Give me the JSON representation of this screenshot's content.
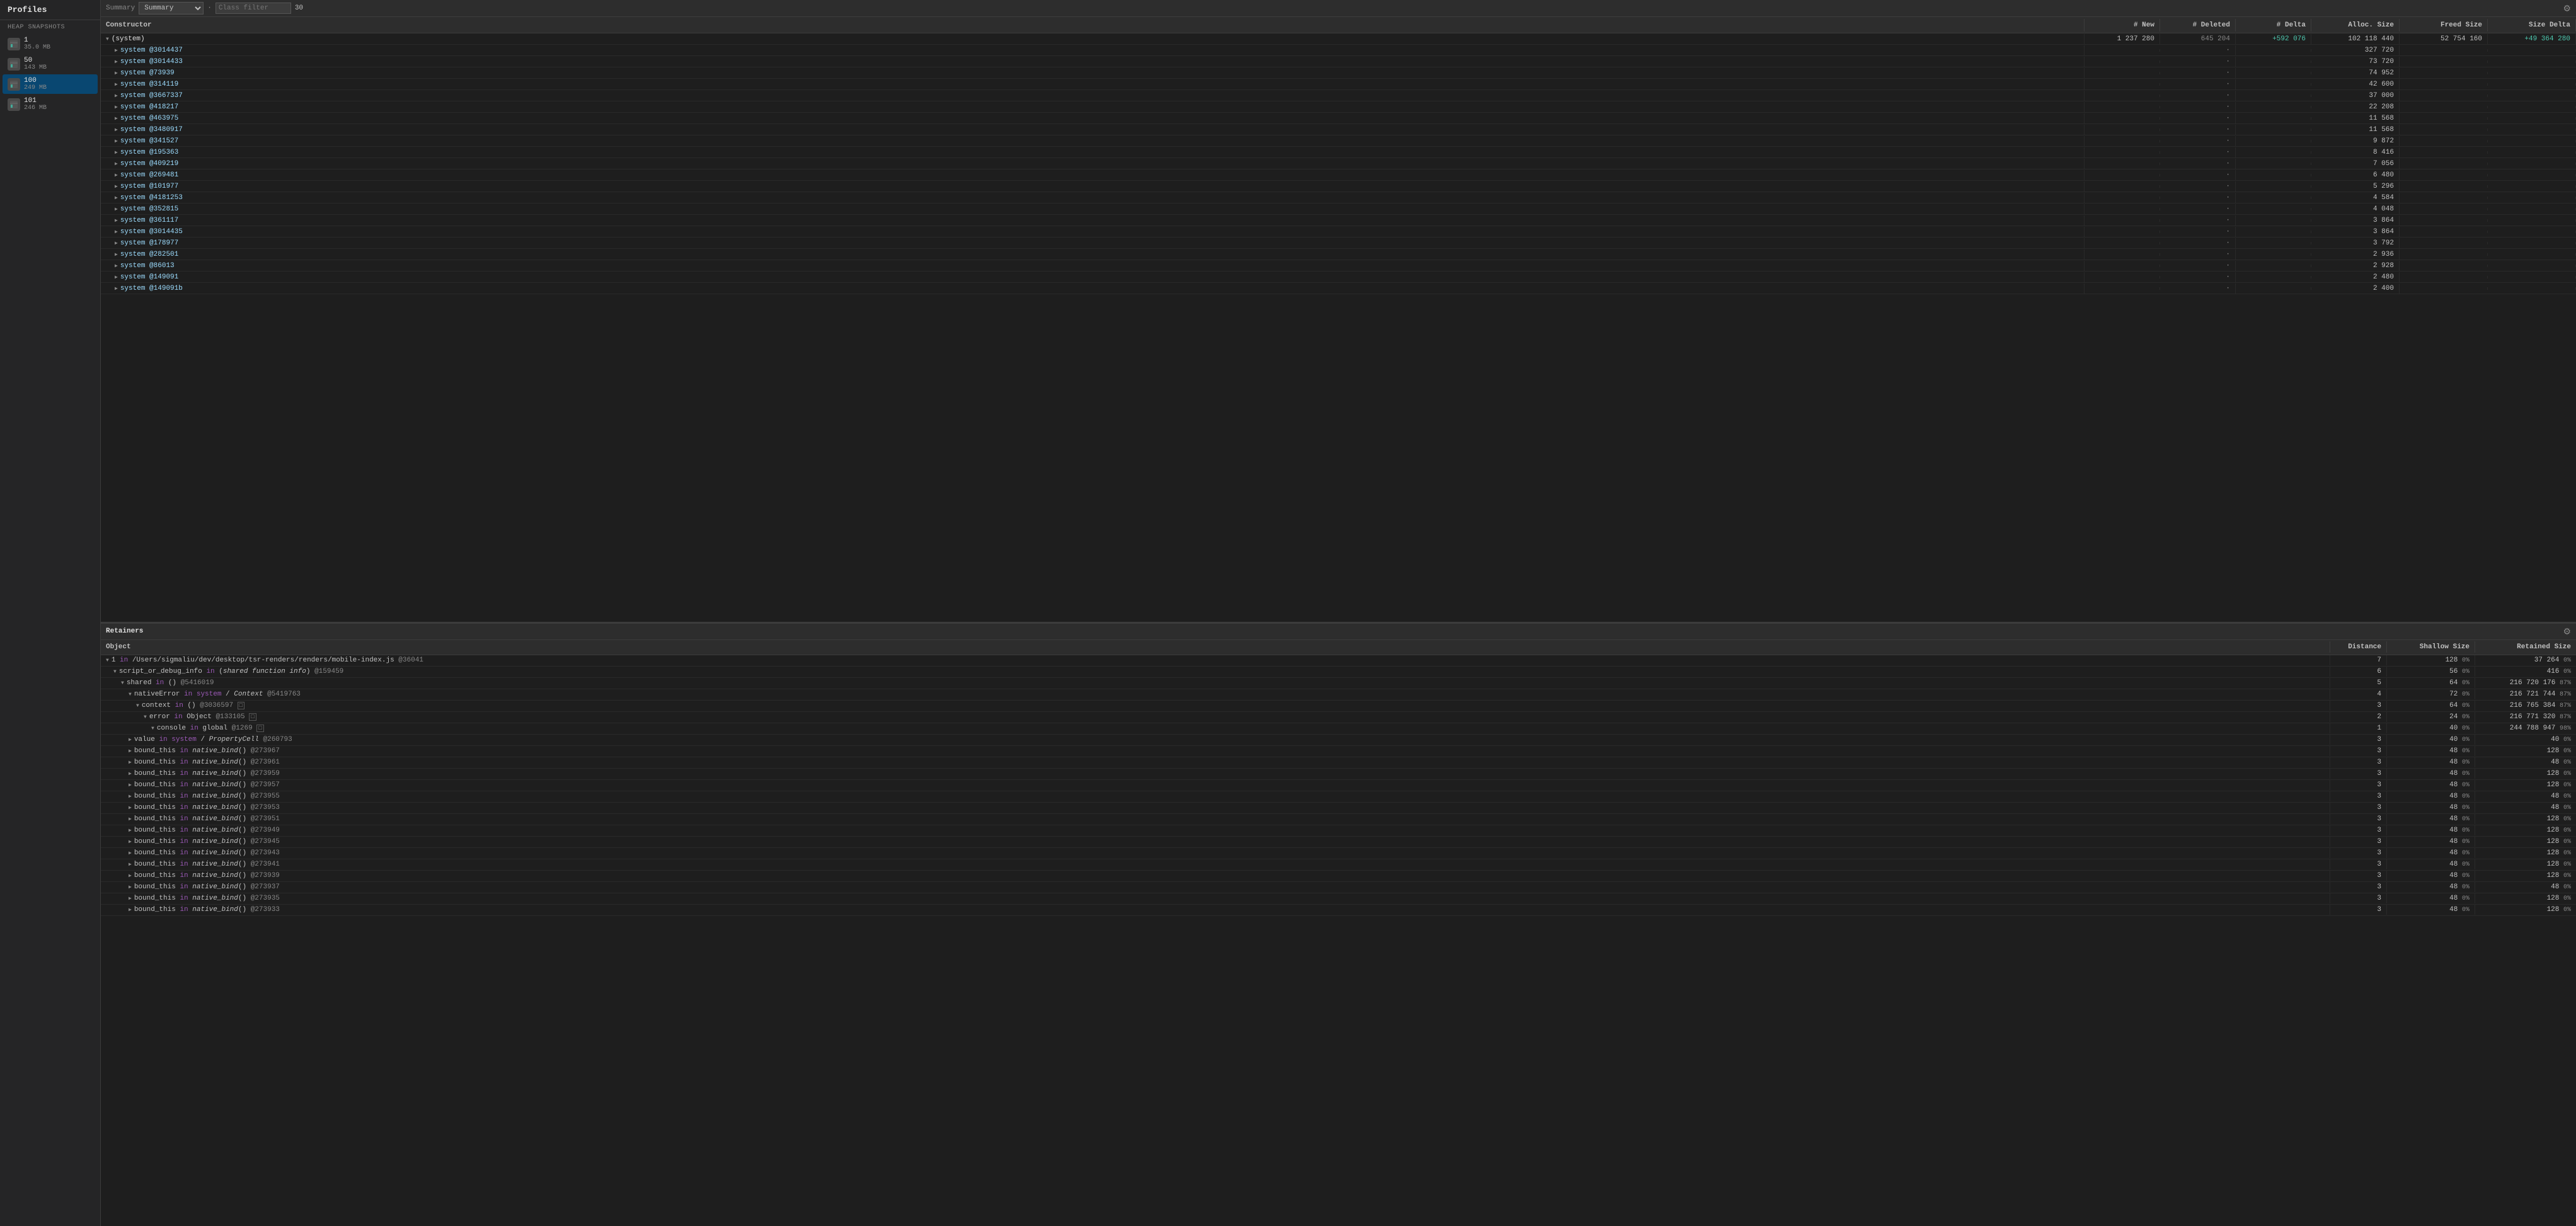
{
  "sidebar": {
    "title": "Profiles",
    "heap_snapshots_label": "HEAP SNAPSHOTS",
    "snapshots": [
      {
        "number": "1",
        "size": "35.0 MB",
        "active": false
      },
      {
        "number": "50",
        "size": "143 MB",
        "active": false
      },
      {
        "number": "100",
        "size": "249 MB",
        "active": true
      },
      {
        "number": "101",
        "size": "246 MB",
        "active": false
      }
    ]
  },
  "toolbar": {
    "summary_label": "Summary",
    "class_filter_label": "Class filter",
    "class_filter_placeholder": "Class filter",
    "value": "30"
  },
  "top_table": {
    "headers": {
      "constructor": "Constructor",
      "new": "# New",
      "deleted": "# Deleted",
      "delta": "# Delta",
      "alloc_size": "Alloc. Size",
      "freed_size": "Freed Size",
      "size_delta": "Size Delta"
    },
    "rows": [
      {
        "name": "(system)",
        "depth": 0,
        "expanded": true,
        "new": "1 237 280",
        "deleted": "645 204",
        "delta": "+592 076",
        "alloc_size": "102 118 440",
        "freed_size": "52 754 160",
        "size_delta": "+49 364 280"
      },
      {
        "name": "system @3014437",
        "depth": 1,
        "expanded": false,
        "new": "",
        "deleted": "·",
        "delta": "",
        "alloc_size": "327 720",
        "freed_size": "",
        "size_delta": ""
      },
      {
        "name": "system @3014433",
        "depth": 1,
        "expanded": false,
        "new": "",
        "deleted": "·",
        "delta": "",
        "alloc_size": "73 720",
        "freed_size": "",
        "size_delta": ""
      },
      {
        "name": "system @73939",
        "depth": 1,
        "expanded": false,
        "new": "",
        "deleted": "·",
        "delta": "",
        "alloc_size": "74 952",
        "freed_size": "",
        "size_delta": ""
      },
      {
        "name": "system @314119",
        "depth": 1,
        "expanded": false,
        "new": "",
        "deleted": "·",
        "delta": "",
        "alloc_size": "42 600",
        "freed_size": "",
        "size_delta": ""
      },
      {
        "name": "system @3667337",
        "depth": 1,
        "expanded": false,
        "new": "",
        "deleted": "·",
        "delta": "",
        "alloc_size": "37 000",
        "freed_size": "",
        "size_delta": ""
      },
      {
        "name": "system @418217",
        "depth": 1,
        "expanded": false,
        "new": "",
        "deleted": "·",
        "delta": "",
        "alloc_size": "22 208",
        "freed_size": "",
        "size_delta": ""
      },
      {
        "name": "system @463975",
        "depth": 1,
        "expanded": false,
        "new": "",
        "deleted": "·",
        "delta": "",
        "alloc_size": "11 568",
        "freed_size": "",
        "size_delta": ""
      },
      {
        "name": "system @3480917",
        "depth": 1,
        "expanded": false,
        "new": "",
        "deleted": "·",
        "delta": "",
        "alloc_size": "11 568",
        "freed_size": "",
        "size_delta": ""
      },
      {
        "name": "system @341527",
        "depth": 1,
        "expanded": false,
        "new": "",
        "deleted": "·",
        "delta": "",
        "alloc_size": "9 872",
        "freed_size": "",
        "size_delta": ""
      },
      {
        "name": "system @195363",
        "depth": 1,
        "expanded": false,
        "new": "",
        "deleted": "·",
        "delta": "",
        "alloc_size": "8 416",
        "freed_size": "",
        "size_delta": ""
      },
      {
        "name": "system @409219",
        "depth": 1,
        "expanded": false,
        "new": "",
        "deleted": "·",
        "delta": "",
        "alloc_size": "7 056",
        "freed_size": "",
        "size_delta": ""
      },
      {
        "name": "system @269481",
        "depth": 1,
        "expanded": false,
        "new": "",
        "deleted": "·",
        "delta": "",
        "alloc_size": "6 480",
        "freed_size": "",
        "size_delta": ""
      },
      {
        "name": "system @101977",
        "depth": 1,
        "expanded": false,
        "new": "",
        "deleted": "·",
        "delta": "",
        "alloc_size": "5 296",
        "freed_size": "",
        "size_delta": ""
      },
      {
        "name": "system @4181253",
        "depth": 1,
        "expanded": false,
        "new": "",
        "deleted": "·",
        "delta": "",
        "alloc_size": "4 584",
        "freed_size": "",
        "size_delta": ""
      },
      {
        "name": "system @352815",
        "depth": 1,
        "expanded": false,
        "new": "",
        "deleted": "·",
        "delta": "",
        "alloc_size": "4 048",
        "freed_size": "",
        "size_delta": ""
      },
      {
        "name": "system @361117",
        "depth": 1,
        "expanded": false,
        "new": "",
        "deleted": "·",
        "delta": "",
        "alloc_size": "3 864",
        "freed_size": "",
        "size_delta": ""
      },
      {
        "name": "system @3014435",
        "depth": 1,
        "expanded": false,
        "new": "",
        "deleted": "·",
        "delta": "",
        "alloc_size": "3 864",
        "freed_size": "",
        "size_delta": ""
      },
      {
        "name": "system @178977",
        "depth": 1,
        "expanded": false,
        "new": "",
        "deleted": "·",
        "delta": "",
        "alloc_size": "3 792",
        "freed_size": "",
        "size_delta": ""
      },
      {
        "name": "system @282501",
        "depth": 1,
        "expanded": false,
        "new": "",
        "deleted": "·",
        "delta": "",
        "alloc_size": "2 936",
        "freed_size": "",
        "size_delta": ""
      },
      {
        "name": "system @86013",
        "depth": 1,
        "expanded": false,
        "new": "",
        "deleted": "·",
        "delta": "",
        "alloc_size": "2 928",
        "freed_size": "",
        "size_delta": ""
      },
      {
        "name": "system @149091",
        "depth": 1,
        "expanded": false,
        "new": "",
        "deleted": "·",
        "delta": "",
        "alloc_size": "2 480",
        "freed_size": "",
        "size_delta": ""
      },
      {
        "name": "system @149091b",
        "depth": 1,
        "expanded": false,
        "new": "",
        "deleted": "·",
        "delta": "",
        "alloc_size": "2 400",
        "freed_size": "",
        "size_delta": ""
      }
    ]
  },
  "retainers": {
    "title": "Retainers",
    "headers": {
      "object": "Object",
      "distance": "Distance",
      "shallow_size": "Shallow Size",
      "retained_size": "Retained Size"
    },
    "rows": [
      {
        "object": "1 in /Users/sigmaliu/dev/desktop/tsr-renders/renders/mobile-index.js @36041",
        "depth": 0,
        "expanded": true,
        "distance": "7",
        "shallow": "128",
        "shallow_pct": "0%",
        "retained": "37 264",
        "retained_pct": "0%"
      },
      {
        "object": "script_or_debug_info in (shared function info) @159459",
        "depth": 1,
        "expanded": true,
        "distance": "6",
        "shallow": "56",
        "shallow_pct": "0%",
        "retained": "416",
        "retained_pct": "0%"
      },
      {
        "object": "shared in () @5416019",
        "depth": 2,
        "expanded": true,
        "distance": "5",
        "shallow": "64",
        "shallow_pct": "0%",
        "retained": "216 720 176",
        "retained_pct": "87%"
      },
      {
        "object": "nativeError in system / Context @5419763",
        "depth": 3,
        "expanded": true,
        "distance": "4",
        "shallow": "72",
        "shallow_pct": "0%",
        "retained": "216 721 744",
        "retained_pct": "87%"
      },
      {
        "object": "context in () @3036597",
        "depth": 4,
        "expanded": true,
        "distance": "3",
        "shallow": "64",
        "shallow_pct": "0%",
        "retained": "216 765 384",
        "retained_pct": "87%"
      },
      {
        "object": "error in Object @133105",
        "depth": 5,
        "expanded": true,
        "distance": "2",
        "shallow": "24",
        "shallow_pct": "0%",
        "retained": "216 771 320",
        "retained_pct": "87%"
      },
      {
        "object": "console in global @1269",
        "depth": 6,
        "expanded": true,
        "distance": "1",
        "shallow": "40",
        "shallow_pct": "0%",
        "retained": "244 788 947",
        "retained_pct": "98%"
      },
      {
        "object": "value in system / PropertyCell @260793",
        "depth": 3,
        "expanded": false,
        "distance": "3",
        "shallow": "40",
        "shallow_pct": "0%",
        "retained": "40",
        "retained_pct": "0%"
      },
      {
        "object": "bound_this in native_bind() @273967",
        "depth": 3,
        "expanded": false,
        "distance": "3",
        "shallow": "48",
        "shallow_pct": "0%",
        "retained": "128",
        "retained_pct": "0%"
      },
      {
        "object": "bound_this in native_bind() @273961",
        "depth": 3,
        "expanded": false,
        "distance": "3",
        "shallow": "48",
        "shallow_pct": "0%",
        "retained": "48",
        "retained_pct": "0%"
      },
      {
        "object": "bound_this in native_bind() @273959",
        "depth": 3,
        "expanded": false,
        "distance": "3",
        "shallow": "48",
        "shallow_pct": "0%",
        "retained": "128",
        "retained_pct": "0%"
      },
      {
        "object": "bound_this in native_bind() @273957",
        "depth": 3,
        "expanded": false,
        "distance": "3",
        "shallow": "48",
        "shallow_pct": "0%",
        "retained": "128",
        "retained_pct": "0%"
      },
      {
        "object": "bound_this in native_bind() @273955",
        "depth": 3,
        "expanded": false,
        "distance": "3",
        "shallow": "48",
        "shallow_pct": "0%",
        "retained": "48",
        "retained_pct": "0%"
      },
      {
        "object": "bound_this in native_bind() @273953",
        "depth": 3,
        "expanded": false,
        "distance": "3",
        "shallow": "48",
        "shallow_pct": "0%",
        "retained": "48",
        "retained_pct": "0%"
      },
      {
        "object": "bound_this in native_bind() @273951",
        "depth": 3,
        "expanded": false,
        "distance": "3",
        "shallow": "48",
        "shallow_pct": "0%",
        "retained": "128",
        "retained_pct": "0%"
      },
      {
        "object": "bound_this in native_bind() @273949",
        "depth": 3,
        "expanded": false,
        "distance": "3",
        "shallow": "48",
        "shallow_pct": "0%",
        "retained": "128",
        "retained_pct": "0%"
      },
      {
        "object": "bound_this in native_bind() @273945",
        "depth": 3,
        "expanded": false,
        "distance": "3",
        "shallow": "48",
        "shallow_pct": "0%",
        "retained": "128",
        "retained_pct": "0%"
      },
      {
        "object": "bound_this in native_bind() @273943",
        "depth": 3,
        "expanded": false,
        "distance": "3",
        "shallow": "48",
        "shallow_pct": "0%",
        "retained": "128",
        "retained_pct": "0%"
      },
      {
        "object": "bound_this in native_bind() @273941",
        "depth": 3,
        "expanded": false,
        "distance": "3",
        "shallow": "48",
        "shallow_pct": "0%",
        "retained": "128",
        "retained_pct": "0%"
      },
      {
        "object": "bound_this in native_bind() @273939",
        "depth": 3,
        "expanded": false,
        "distance": "3",
        "shallow": "48",
        "shallow_pct": "0%",
        "retained": "128",
        "retained_pct": "0%"
      },
      {
        "object": "bound_this in native_bind() @273937",
        "depth": 3,
        "expanded": false,
        "distance": "3",
        "shallow": "48",
        "shallow_pct": "0%",
        "retained": "48",
        "retained_pct": "0%"
      },
      {
        "object": "bound_this in native_bind() @273935",
        "depth": 3,
        "expanded": false,
        "distance": "3",
        "shallow": "48",
        "shallow_pct": "0%",
        "retained": "128",
        "retained_pct": "0%"
      },
      {
        "object": "bound_this in native_bind() @273933",
        "depth": 3,
        "expanded": false,
        "distance": "3",
        "shallow": "48",
        "shallow_pct": "0%",
        "retained": "128",
        "retained_pct": "0%"
      }
    ]
  }
}
